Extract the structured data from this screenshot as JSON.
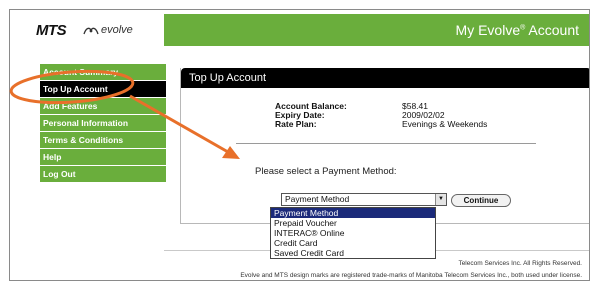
{
  "header": {
    "logo_text": "MTS",
    "brand_text": "evolve",
    "title": "My Evolve",
    "title_mark": "®",
    "title_suffix": " Account"
  },
  "sidebar": {
    "items": [
      {
        "label": "Account Summary"
      },
      {
        "label": "Top Up Account"
      },
      {
        "label": "Add Features"
      },
      {
        "label": "Personal Information"
      },
      {
        "label": "Terms & Conditions"
      },
      {
        "label": "Help"
      },
      {
        "label": "Log Out"
      }
    ]
  },
  "panel": {
    "title": "Top Up Account",
    "info": [
      {
        "label": "Account Balance:",
        "value": "$58.41"
      },
      {
        "label": "Expiry Date:",
        "value": "2009/02/02"
      },
      {
        "label": "Rate Plan:",
        "value": "Evenings & Weekends"
      }
    ],
    "prompt": "Please select a Payment Method:",
    "select_value": "Payment Method",
    "continue_label": "Continue"
  },
  "dropdown": {
    "options": [
      {
        "label": "Payment Method"
      },
      {
        "label": "Prepaid Voucher"
      },
      {
        "label": "INTERAC® Online"
      },
      {
        "label": "Credit Card"
      },
      {
        "label": "Saved Credit Card"
      }
    ],
    "selected_index": 0
  },
  "footer": {
    "line1": "Telecom Services Inc. All Rights Reserved.",
    "line2": "Evolve and MTS design marks are registered trade-marks of Manitoba Telecom Services Inc., both used under license."
  },
  "colors": {
    "brand_green": "#6aae3c",
    "annotation_orange": "#e8702a",
    "dropdown_highlight": "#1b2a7a"
  },
  "icons": [
    "evolve-logo-icon",
    "select-arrow-icon"
  ]
}
